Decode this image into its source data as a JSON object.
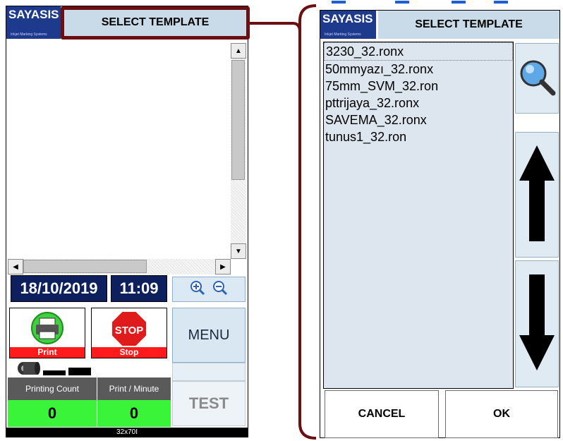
{
  "brand": {
    "logo_text": "SAYASIS",
    "logo_subtext": "Inkjet Marking Systems"
  },
  "left_panel": {
    "title": "SELECT TEMPLATE",
    "date": "18/10/2019",
    "time": "11:09",
    "print_label": "Print",
    "stop_label": "Stop",
    "stop_sign_text": "STOP",
    "menu_label": "MENU",
    "test_label": "TEST",
    "printing_count_label": "Printing Count",
    "print_per_minute_label": "Print / Minute",
    "printing_count_value": "0",
    "print_per_minute_value": "0",
    "status_text": "32x70I"
  },
  "right_panel": {
    "title": "SELECT TEMPLATE",
    "templates": [
      "3230_32.ronx",
      "50mmyazı_32.ronx",
      "75mm_SVM_32.ron",
      "pttrijaya_32.ronx",
      "SAVEMA_32.ronx",
      "tunus1_32.ron"
    ],
    "selected_index": 0,
    "cancel_label": "CANCEL",
    "ok_label": "OK"
  },
  "icons": {
    "search": "magnifier-icon",
    "up": "arrow-up-icon",
    "down": "arrow-down-icon",
    "zoom_in": "zoom-in-icon",
    "zoom_out": "zoom-out-icon",
    "printer": "printer-icon",
    "stop": "stop-sign-icon",
    "ink": "ink-roll-icon"
  },
  "colors": {
    "highlight": "#6b0f12",
    "header_bg": "#c9dbe8",
    "logo_bg": "#1d3a8c",
    "date_bg": "#0d1f5c",
    "count_green": "#3af43a",
    "top_partial_text": "#1f5fd1"
  }
}
